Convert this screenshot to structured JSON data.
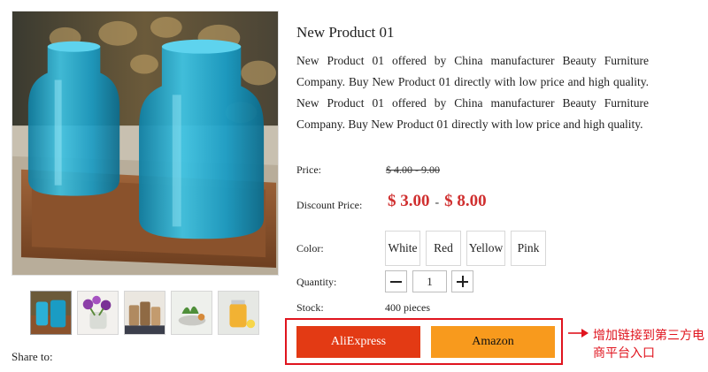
{
  "product": {
    "title": "New Product 01",
    "description": "New Product 01 offered by China manufacturer Beauty Furniture Company. Buy New Product 01 directly with low price and high quality. New Product 01 offered by China manufacturer Beauty Furniture Company. Buy New Product 01 directly with low price and high quality."
  },
  "price": {
    "label": "Price:",
    "original": "$ 4.00 - 9.00"
  },
  "discount": {
    "label": "Discount Price:",
    "low": "$ 3.00",
    "separator": "-",
    "high": "$ 8.00",
    "color": "#d03030"
  },
  "color": {
    "label": "Color:",
    "options": [
      "White",
      "Red",
      "Yellow",
      "Pink"
    ]
  },
  "quantity": {
    "label": "Quantity:",
    "value": "1"
  },
  "stock": {
    "label": "Stock:",
    "value": "400 pieces"
  },
  "marketplaces": {
    "aliexpress_label": "AliExpress",
    "amazon_label": "Amazon",
    "aliexpress_color": "#e33a14",
    "amazon_color": "#f89a1d"
  },
  "share": {
    "label": "Share to:"
  },
  "annotation": {
    "text": "增加链接到第三方电商平台入口",
    "color": "#e0141e"
  },
  "icons": {
    "decrease": "minus-icon",
    "increase": "plus-icon",
    "pointer": "arrow-right-icon"
  }
}
